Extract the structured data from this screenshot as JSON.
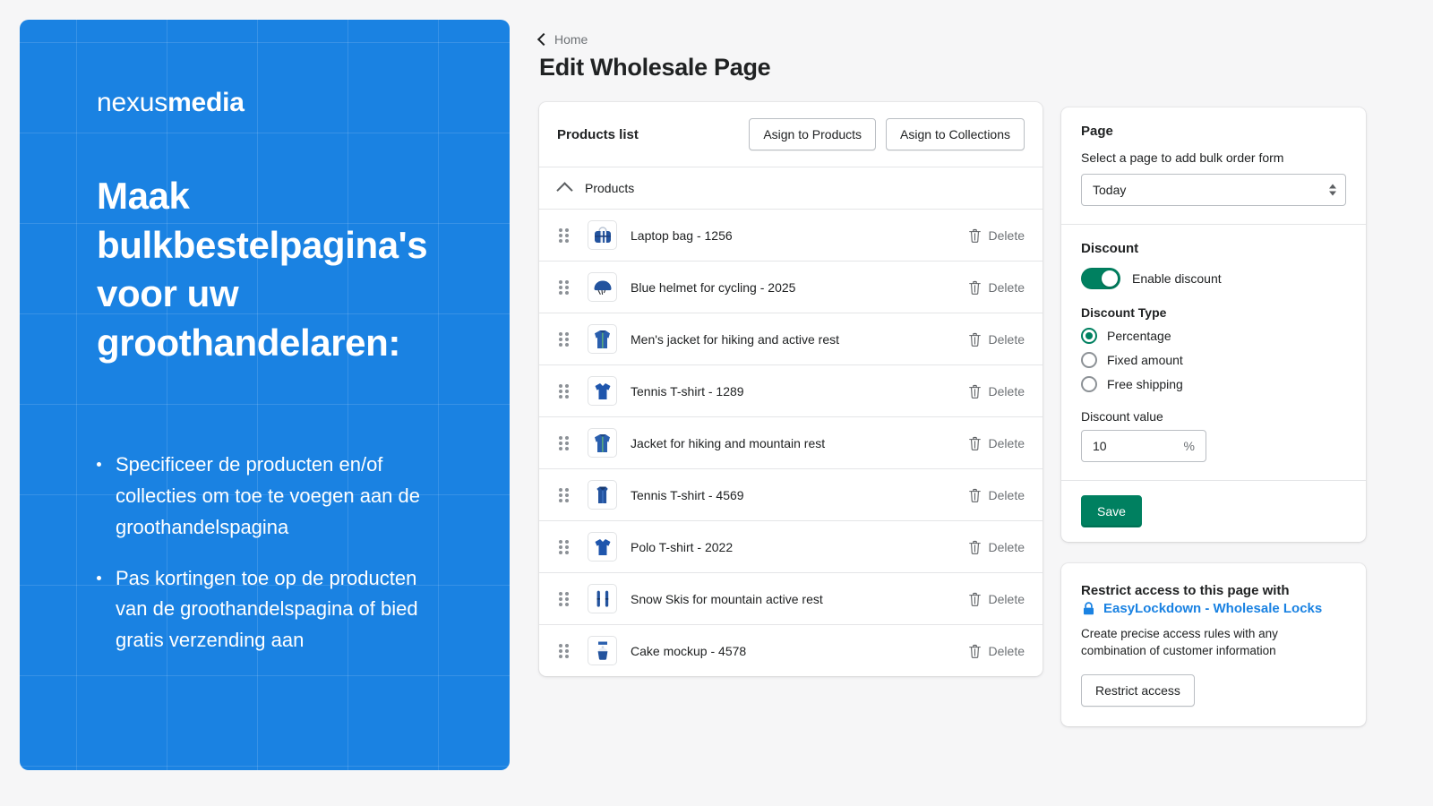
{
  "promo": {
    "logo_light": "nexus",
    "logo_bold": "media",
    "heading": "Maak bulkbestelpagina's voor uw groothandelaren:",
    "bullets": [
      "Specificeer de producten en/of collecties om toe te voegen aan de groothandelspagina",
      "Pas kortingen toe op de producten van de groothandelspagina of bied gratis verzending aan"
    ],
    "bg_color": "#1a82e2"
  },
  "breadcrumb": {
    "label": "Home"
  },
  "page_title": "Edit Wholesale Page",
  "products_card": {
    "title": "Products list",
    "assign_products_label": "Asign to Products",
    "assign_collections_label": "Asign to Collections",
    "group_label": "Products",
    "delete_label": "Delete",
    "items": [
      {
        "name": "Laptop bag - 1256",
        "icon": "laptop-bag-thumbnail"
      },
      {
        "name": "Blue helmet for cycling - 2025",
        "icon": "helmet-thumbnail"
      },
      {
        "name": "Men's jacket for hiking and active rest",
        "icon": "jacket-thumbnail"
      },
      {
        "name": "Tennis T-shirt - 1289",
        "icon": "polo-shirt-thumbnail"
      },
      {
        "name": "Jacket for hiking and mountain rest",
        "icon": "jacket-thumbnail"
      },
      {
        "name": "Tennis T-shirt - 4569",
        "icon": "tank-top-thumbnail"
      },
      {
        "name": "Polo T-shirt - 2022",
        "icon": "polo-shirt-thumbnail"
      },
      {
        "name": "Snow Skis for mountain active rest",
        "icon": "skis-thumbnail"
      },
      {
        "name": "Cake mockup - 4578",
        "icon": "cake-thumbnail"
      }
    ]
  },
  "sidebar": {
    "page_section": {
      "title": "Page",
      "hint": "Select a page to add bulk order form",
      "select_value": "Today"
    },
    "discount_section": {
      "title": "Discount",
      "toggle_label": "Enable discount",
      "toggle_on": true,
      "type_label": "Discount Type",
      "types": [
        {
          "label": "Percentage",
          "selected": true
        },
        {
          "label": "Fixed amount",
          "selected": false
        },
        {
          "label": "Free shipping",
          "selected": false
        }
      ],
      "value_label": "Discount value",
      "value": "10",
      "value_suffix": "%"
    },
    "save_label": "Save",
    "lockdown_card": {
      "line1": "Restrict access to this page with",
      "link": "EasyLockdown - Wholesale Locks",
      "link_color": "#1a82e2",
      "description": "Create precise access rules with any combination of customer information",
      "button_label": "Restrict access"
    }
  },
  "colors": {
    "accent_green": "#008060",
    "brand_blue": "#1a82e2"
  }
}
